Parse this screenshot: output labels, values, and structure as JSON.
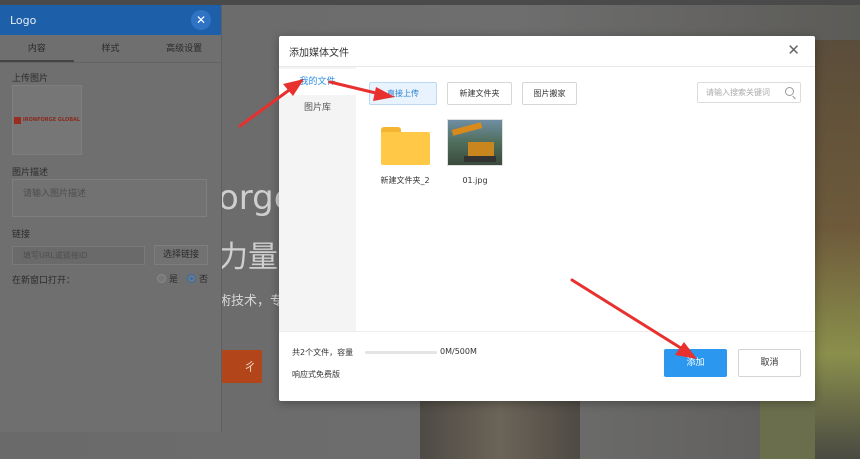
{
  "background": {
    "headline_fragment": "orge",
    "headline2_fragment": "力量",
    "subtitle_fragment": "術技术，专",
    "cta_fragment": "ㄔ"
  },
  "settings_panel": {
    "title": "Logo",
    "close_glyph": "✕",
    "tabs": [
      "内容",
      "样式",
      "高级设置"
    ],
    "upload_label": "上传图片",
    "logo_text": "IRONFORGE GLOBAL",
    "description_label": "图片描述",
    "description_placeholder": "请输入图片描述",
    "link_label": "链接",
    "link_placeholder": "填写URL或链接ID",
    "select_link_button": "选择链接",
    "new_window_label": "在新窗口打开：",
    "option_yes": "是",
    "option_no": "否"
  },
  "modal": {
    "title": "添加媒体文件",
    "close_glyph": "✕",
    "sidebar": [
      "我的文件",
      "图片库"
    ],
    "toolbar": {
      "upload": "直接上传",
      "new_folder": "新建文件夹",
      "move_image": "图片搬家",
      "search_placeholder": "请输入搜索关键词"
    },
    "files": [
      {
        "name": "新建文件夹_2",
        "type": "folder"
      },
      {
        "name": "01.jpg",
        "type": "image"
      }
    ],
    "footer": {
      "count_text": "共2个文件，容量",
      "capacity_text": "0M/500M",
      "capacity_fraction": 0,
      "edition": "响应式免费版",
      "add_button": "添加",
      "cancel_button": "取消"
    }
  },
  "colors": {
    "accent": "#2b97ee",
    "panel_header": "#1d5fa8",
    "annotation_arrow": "#e8312e",
    "folder": "#ffc947"
  }
}
